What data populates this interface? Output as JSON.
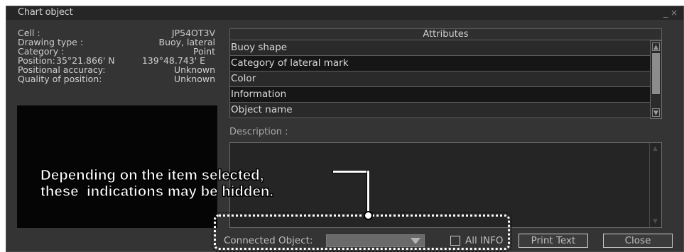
{
  "window": {
    "title": "Chart object",
    "minimize_glyph": "_ ×"
  },
  "info": {
    "cell_label": "Cell :",
    "cell_value": "JP54OT3V",
    "drawing_type_label": "Drawing type :",
    "drawing_type_value": "Buoy, lateral",
    "category_label": "Category :",
    "category_value": "Point",
    "position_label": "Position:",
    "position_lat": "35°21.866' N",
    "position_lon": "139°48.743' E",
    "accuracy_label": "Positional accuracy:",
    "accuracy_value": "Unknown",
    "quality_label": "Quality of position:",
    "quality_value": "Unknown"
  },
  "attributes": {
    "header": "Attributes",
    "rows": [
      "Buoy shape",
      "Category of lateral mark",
      "Color",
      "Information",
      "Object name"
    ]
  },
  "description": {
    "label": "Description :"
  },
  "bottom": {
    "connected_label": "Connected Object:",
    "connected_value": "",
    "all_info_label": "All INFO",
    "all_info_checked": false,
    "print_label": "Print Text",
    "close_label": "Close"
  },
  "annotation": {
    "line1": "Depending on the item selected,",
    "line2": "these  indications may be hidden."
  },
  "icons": {
    "scroll_up": "up-arrow-icon",
    "scroll_down": "down-arrow-icon",
    "dropdown": "chevron-down-icon"
  },
  "colors": {
    "window_bg": "#343434",
    "titlebar_bg": "#262626",
    "text": "#cfcfcf"
  }
}
